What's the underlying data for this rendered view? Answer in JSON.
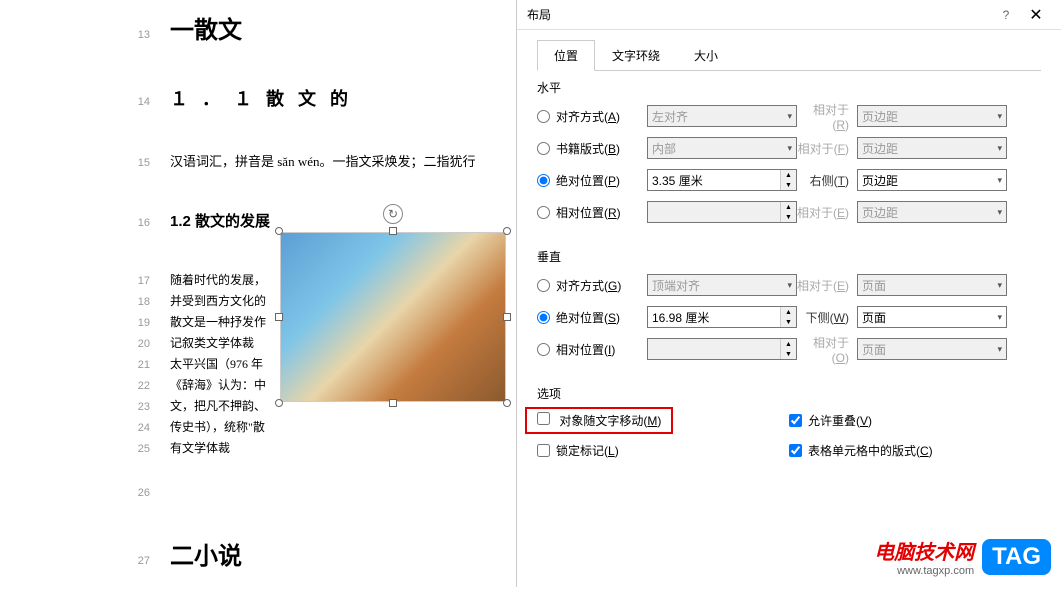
{
  "document": {
    "lines": [
      {
        "num": "13",
        "text": "一散文",
        "cls": "h1 mb"
      },
      {
        "num": "14",
        "text": "１．１散文的",
        "cls": "h2 mb mt"
      },
      {
        "num": "15",
        "text": "汉语词汇，拼音是 sǎn wén。一指文采焕发；二指犹行",
        "cls": "para mb mt"
      },
      {
        "num": "16",
        "text": "1.2 散文的发展",
        "cls": "h3 mb mt"
      },
      {
        "num": "17",
        "text": "随着时代的发展，",
        "cls": "para-small mt"
      },
      {
        "num": "18",
        "text": "并受到西方文化的",
        "cls": "para-small"
      },
      {
        "num": "19",
        "text": "散文是一种抒发作",
        "cls": "para-small"
      },
      {
        "num": "20",
        "text": "记叙类文学体裁",
        "cls": "para-small"
      },
      {
        "num": "21",
        "text": "太平兴国（976 年",
        "cls": "para-small"
      },
      {
        "num": "22",
        "text": "《辞海》认为：中",
        "cls": "para-small"
      },
      {
        "num": "23",
        "text": "文，把凡不押韵、",
        "cls": "para-small"
      },
      {
        "num": "24",
        "text": "传史书），统称\"散",
        "cls": "para-small"
      },
      {
        "num": "25",
        "text": "有文学体裁",
        "cls": "para-small mb"
      },
      {
        "num": "26",
        "text": "",
        "cls": "para mb mt"
      },
      {
        "num": "27",
        "text": "二小说",
        "cls": "h1 mt"
      }
    ]
  },
  "dialog": {
    "title": "布局",
    "tabs": {
      "position": "位置",
      "textwrap": "文字环绕",
      "size": "大小"
    },
    "horizontal": {
      "title": "水平",
      "align": {
        "label": "对齐方式(A)",
        "value": "左对齐",
        "rel_label": "相对于(R)",
        "rel_value": "页边距"
      },
      "book": {
        "label": "书籍版式(B)",
        "value": "内部",
        "rel_label": "相对于(F)",
        "rel_value": "页边距"
      },
      "abs": {
        "label": "绝对位置(P)",
        "value": "3.35 厘米",
        "rel_label": "右侧(T)",
        "rel_value": "页边距"
      },
      "rel": {
        "label": "相对位置(R)",
        "value": "",
        "rel_label": "相对于(E)",
        "rel_value": "页边距"
      }
    },
    "vertical": {
      "title": "垂直",
      "align": {
        "label": "对齐方式(G)",
        "value": "顶端对齐",
        "rel_label": "相对于(E)",
        "rel_value": "页面"
      },
      "abs": {
        "label": "绝对位置(S)",
        "value": "16.98 厘米",
        "rel_label": "下侧(W)",
        "rel_value": "页面"
      },
      "rel": {
        "label": "相对位置(I)",
        "value": "",
        "rel_label": "相对于(O)",
        "rel_value": "页面"
      }
    },
    "options": {
      "title": "选项",
      "movewith": "对象随文字移动(M)",
      "lock": "锁定标记(L)",
      "overlap": "允许重叠(V)",
      "tablecell": "表格单元格中的版式(C)"
    }
  },
  "watermark": {
    "title": "电脑技术网",
    "url": "www.tagxp.com",
    "tag": "TAG"
  }
}
